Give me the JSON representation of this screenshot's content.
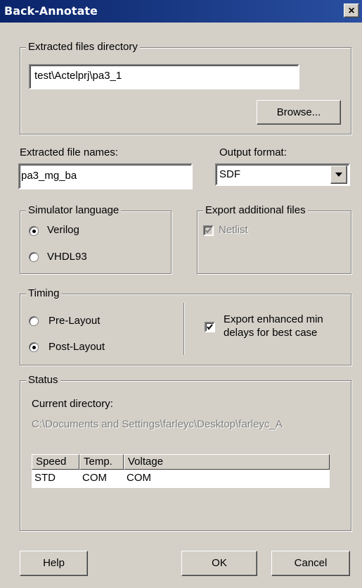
{
  "window": {
    "title": "Back-Annotate",
    "close_glyph": "×"
  },
  "extracted_dir": {
    "legend": "Extracted files directory",
    "value": "test\\Actelprj\\pa3_1",
    "browse_label": "Browse..."
  },
  "file_names": {
    "label": "Extracted file names:",
    "value": "pa3_mg_ba"
  },
  "output_format": {
    "label": "Output format:",
    "value": "SDF"
  },
  "simulator": {
    "legend": "Simulator language",
    "options": [
      {
        "label": "Verilog",
        "selected": true
      },
      {
        "label": "VHDL93",
        "selected": false
      }
    ]
  },
  "export_additional": {
    "legend": "Export additional files",
    "netlist_label": "Netlist",
    "netlist_checked": true,
    "netlist_enabled": false
  },
  "timing": {
    "legend": "Timing",
    "options": [
      {
        "label": "Pre-Layout",
        "selected": false
      },
      {
        "label": "Post-Layout",
        "selected": true
      }
    ],
    "enhanced_label_line1": "Export enhanced min",
    "enhanced_label_line2": "delays for best case",
    "enhanced_checked": true
  },
  "status": {
    "legend": "Status",
    "current_dir_label": "Current directory:",
    "current_dir_value": "C:\\Documents and Settings\\farleyc\\Desktop\\farleyc_A",
    "table": {
      "headers": [
        "Speed",
        "Temp.",
        "Voltage"
      ],
      "rows": [
        [
          "STD",
          "COM",
          "COM"
        ]
      ]
    }
  },
  "footer": {
    "help_label": "Help",
    "ok_label": "OK",
    "cancel_label": "Cancel"
  }
}
